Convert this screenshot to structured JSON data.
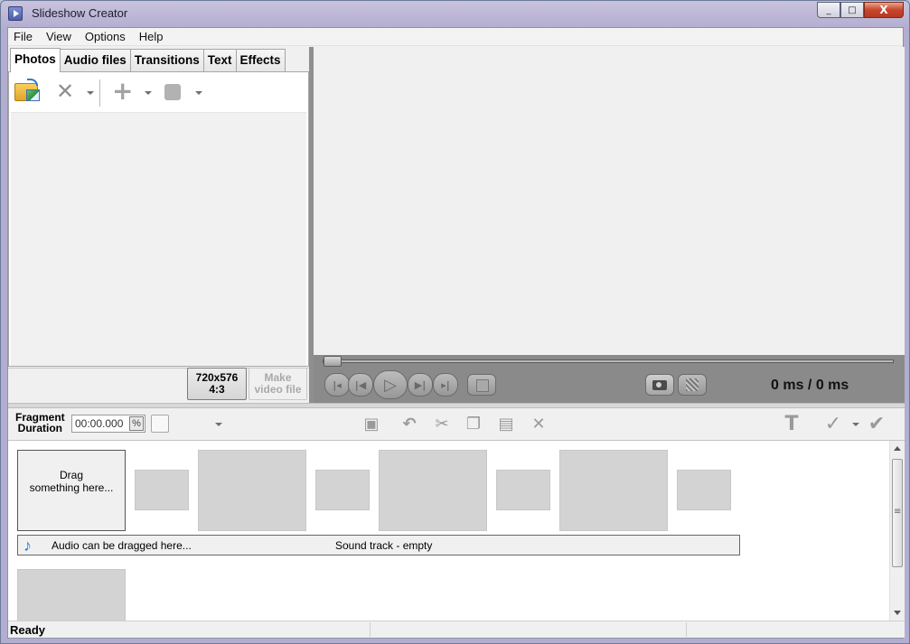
{
  "window": {
    "title": "Slideshow Creator",
    "controls": [
      "_",
      "□",
      "X"
    ]
  },
  "menu": [
    "File",
    "View",
    "Options",
    "Help"
  ],
  "tabs": [
    "Photos",
    "Audio files",
    "Transitions",
    "Text",
    "Effects"
  ],
  "active_tab": "Photos",
  "resolution_button": {
    "line1": "720x576",
    "line2": "4:3"
  },
  "make_video_button": {
    "line1": "Make",
    "line2": "video file",
    "enabled": false
  },
  "player": {
    "time_current": "0 ms",
    "time_total": "/ 0 ms"
  },
  "edit_toolbar": {
    "fragment_label_1": "Fragment",
    "fragment_label_2": "Duration",
    "duration_value": "00:00.000"
  },
  "timeline": {
    "drag_hint_1": "Drag",
    "drag_hint_2": "something here...",
    "audio_hint": "Audio can be dragged here...",
    "sound_track_status": "Sound track - empty"
  },
  "status": {
    "text": "Ready"
  },
  "colors": {
    "window_frame": "#b3aed0",
    "player_bg": "#8a8a8a",
    "placeholder": "#d3d3d3",
    "note_icon": "#1e7de0"
  }
}
